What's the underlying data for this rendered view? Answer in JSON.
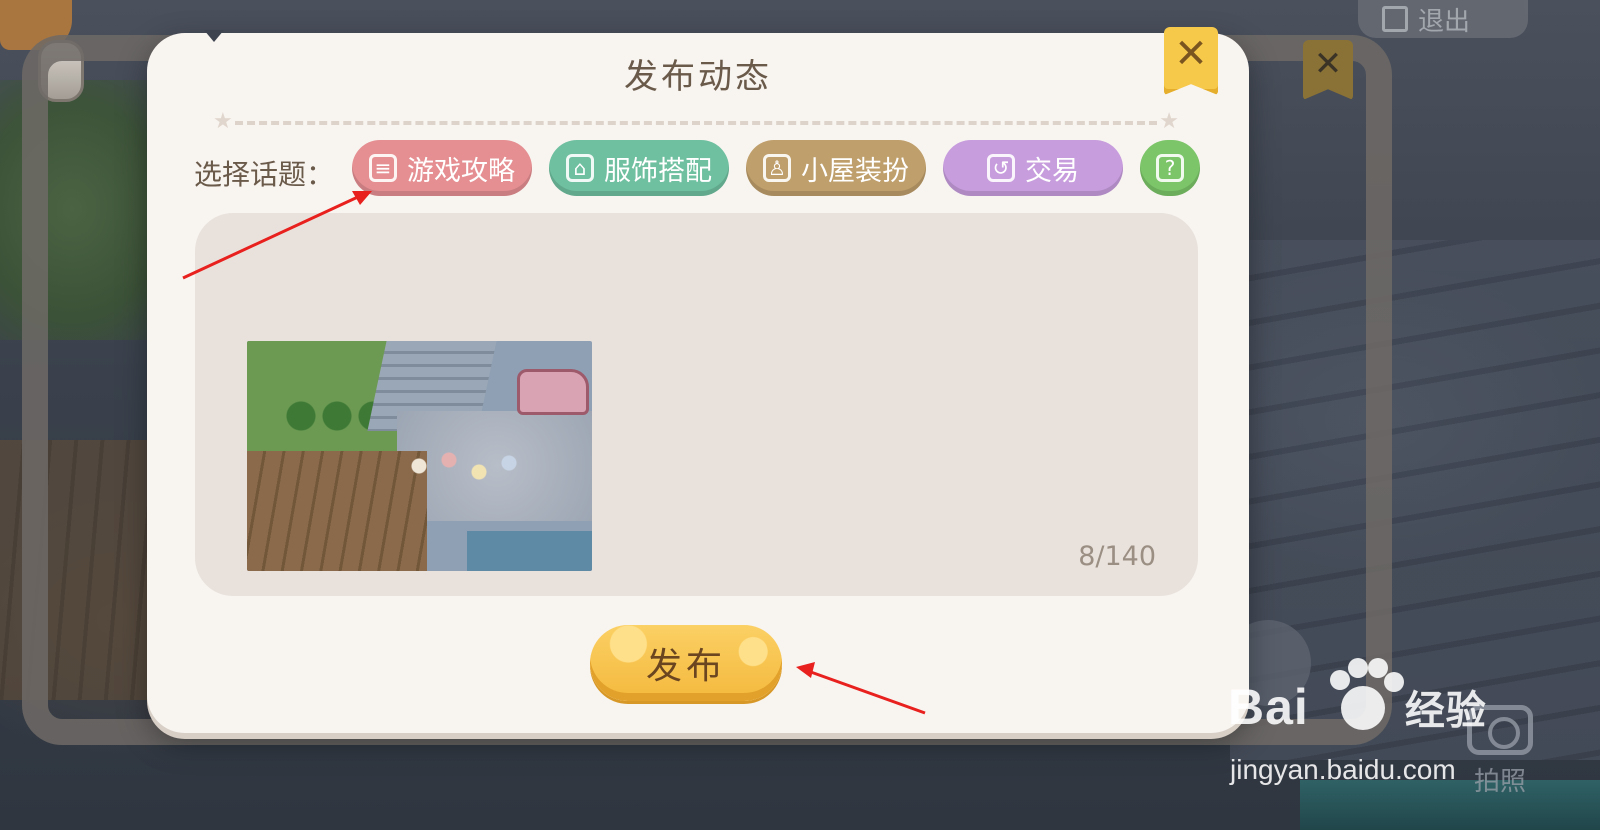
{
  "dialog": {
    "title": "发布动态",
    "topic_label": "选择话题：",
    "topics": [
      {
        "label": "游戏攻略",
        "icon": "guide-book-icon",
        "color": "#e58f92"
      },
      {
        "label": "服饰搭配",
        "icon": "wardrobe-icon",
        "color": "#6fc0a0"
      },
      {
        "label": "小屋装扮",
        "icon": "house-decor-icon",
        "color": "#bf9f6b"
      },
      {
        "label": "交易",
        "icon": "trade-icon",
        "color": "#c79ddd"
      },
      {
        "label": "",
        "icon": "question-icon",
        "color": "#7cc569"
      }
    ],
    "counter": "8/140",
    "publish_label": "发布",
    "close_icon": "close-icon"
  },
  "background": {
    "exit_label": "退出",
    "camera_label": "拍照"
  },
  "watermark": {
    "logo": "Bai",
    "logo_suffix": "经验",
    "url": "jingyan.baidu.com"
  }
}
